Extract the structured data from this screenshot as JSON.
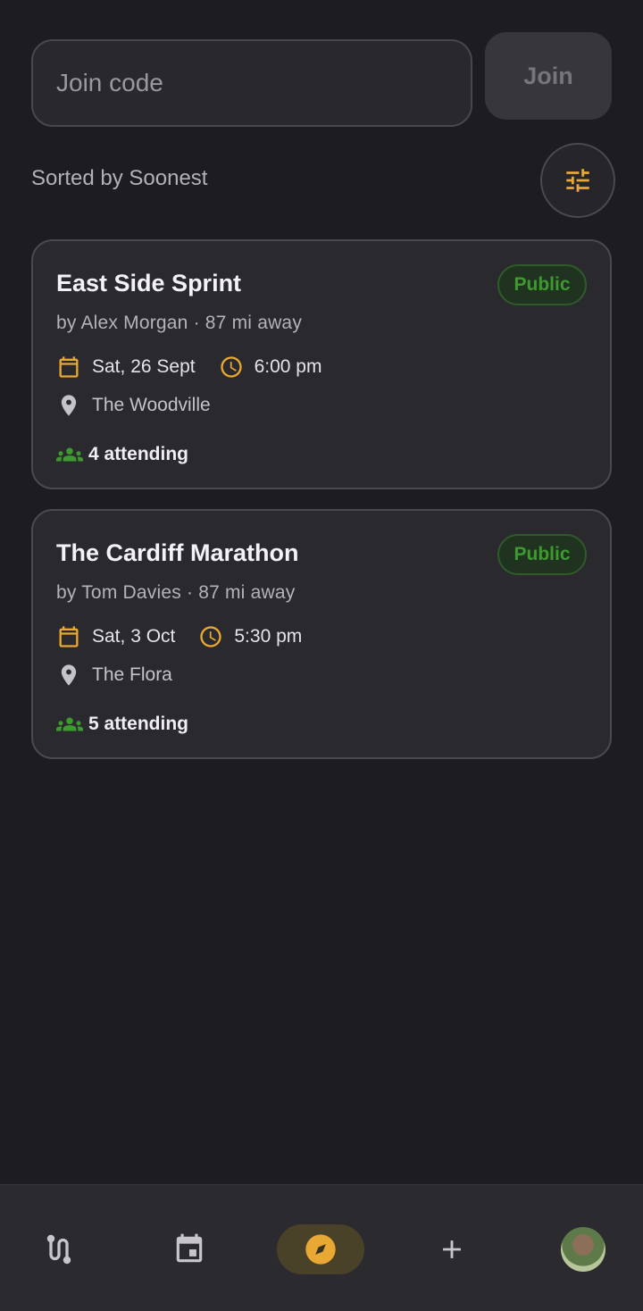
{
  "join": {
    "placeholder": "Join code",
    "value": "",
    "button_label": "Join"
  },
  "sort": {
    "label": "Sorted by Soonest",
    "filter_icon": "tune-icon"
  },
  "events": [
    {
      "title": "East Side Sprint",
      "badge": "Public",
      "byline": "by Alex Morgan · 87 mi away",
      "date": "Sat, 26 Sept",
      "time": "6:00 pm",
      "location": "The Woodville",
      "attending": "4 attending"
    },
    {
      "title": "The Cardiff Marathon",
      "badge": "Public",
      "byline": "by Tom Davies · 87 mi away",
      "date": "Sat, 3 Oct",
      "time": "5:30 pm",
      "location": "The Flora",
      "attending": "5 attending"
    }
  ],
  "nav": {
    "items": [
      {
        "icon": "route-icon",
        "active": false
      },
      {
        "icon": "calendar-icon",
        "active": false
      },
      {
        "icon": "compass-icon",
        "active": true
      },
      {
        "icon": "plus-icon",
        "active": false
      },
      {
        "icon": "avatar",
        "active": false
      }
    ]
  },
  "colors": {
    "background": "#1d1c21",
    "accent": "#e8a833",
    "public_green": "#3e9a2f",
    "card": "#2a292e"
  }
}
